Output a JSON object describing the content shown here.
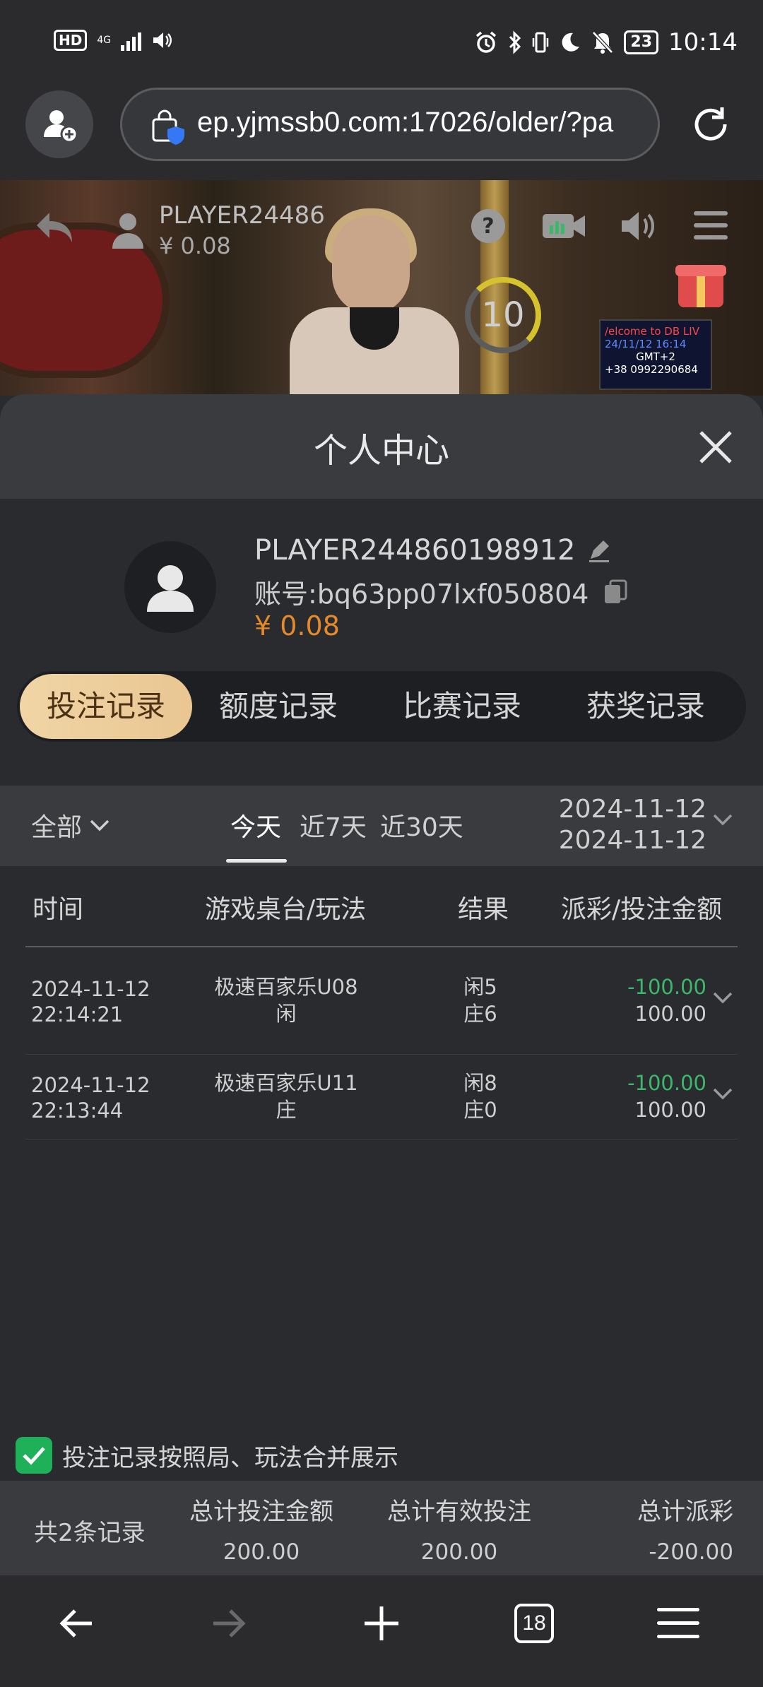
{
  "status_bar": {
    "hd": "HD",
    "network": "4G",
    "time": "10:14",
    "battery": "23"
  },
  "browser": {
    "url": "ep.yjmssb0.com:17026/older/?pa",
    "tab_count": "18"
  },
  "video": {
    "player_name": "PLAYER24486",
    "balance": "¥ 0.08",
    "countdown": "10",
    "sign_line1": "/elcome to DB LIV",
    "sign_line2": "24/11/12  16:14",
    "sign_line3": "GMT+2",
    "sign_line4": "+38 0992290684"
  },
  "sheet": {
    "title": "个人中心"
  },
  "profile": {
    "name": "PLAYER244860198912",
    "account_label": "账号:",
    "account": "bq63pp07lxf050804",
    "balance": "¥ 0.08"
  },
  "tabs": [
    {
      "label": "投注记录",
      "active": true
    },
    {
      "label": "额度记录",
      "active": false
    },
    {
      "label": "比赛记录",
      "active": false
    },
    {
      "label": "获奖记录",
      "active": false
    }
  ],
  "filter": {
    "type": "全部",
    "ranges": [
      "今天",
      "近7天",
      "近30天"
    ],
    "date_from": "2024-11-12",
    "date_to": "2024-11-12"
  },
  "table": {
    "headers": [
      "时间",
      "游戏桌台/玩法",
      "结果",
      "派彩/投注金额"
    ],
    "rows": [
      {
        "date": "2024-11-12",
        "time": "22:14:21",
        "game": "极速百家乐U08",
        "play": "闲",
        "res1": "闲5",
        "res2": "庄6",
        "payout": "-100.00",
        "bet": "100.00"
      },
      {
        "date": "2024-11-12",
        "time": "22:13:44",
        "game": "极速百家乐U11",
        "play": "庄",
        "res1": "闲8",
        "res2": "庄0",
        "payout": "-100.00",
        "bet": "100.00"
      }
    ]
  },
  "merge_option": {
    "label": "投注记录按照局、玩法合并展示",
    "checked": true
  },
  "totals": {
    "count": "共2条记录",
    "bet_label": "总计投注金额",
    "bet_value": "200.00",
    "valid_label": "总计有效投注",
    "valid_value": "200.00",
    "payout_label": "总计派彩",
    "payout_value": "-200.00"
  },
  "colors": {
    "accent_gold": "#e9c692",
    "balance_orange": "#e58a2a",
    "win_green": "#3cb86a",
    "check_green": "#1fb05a"
  }
}
